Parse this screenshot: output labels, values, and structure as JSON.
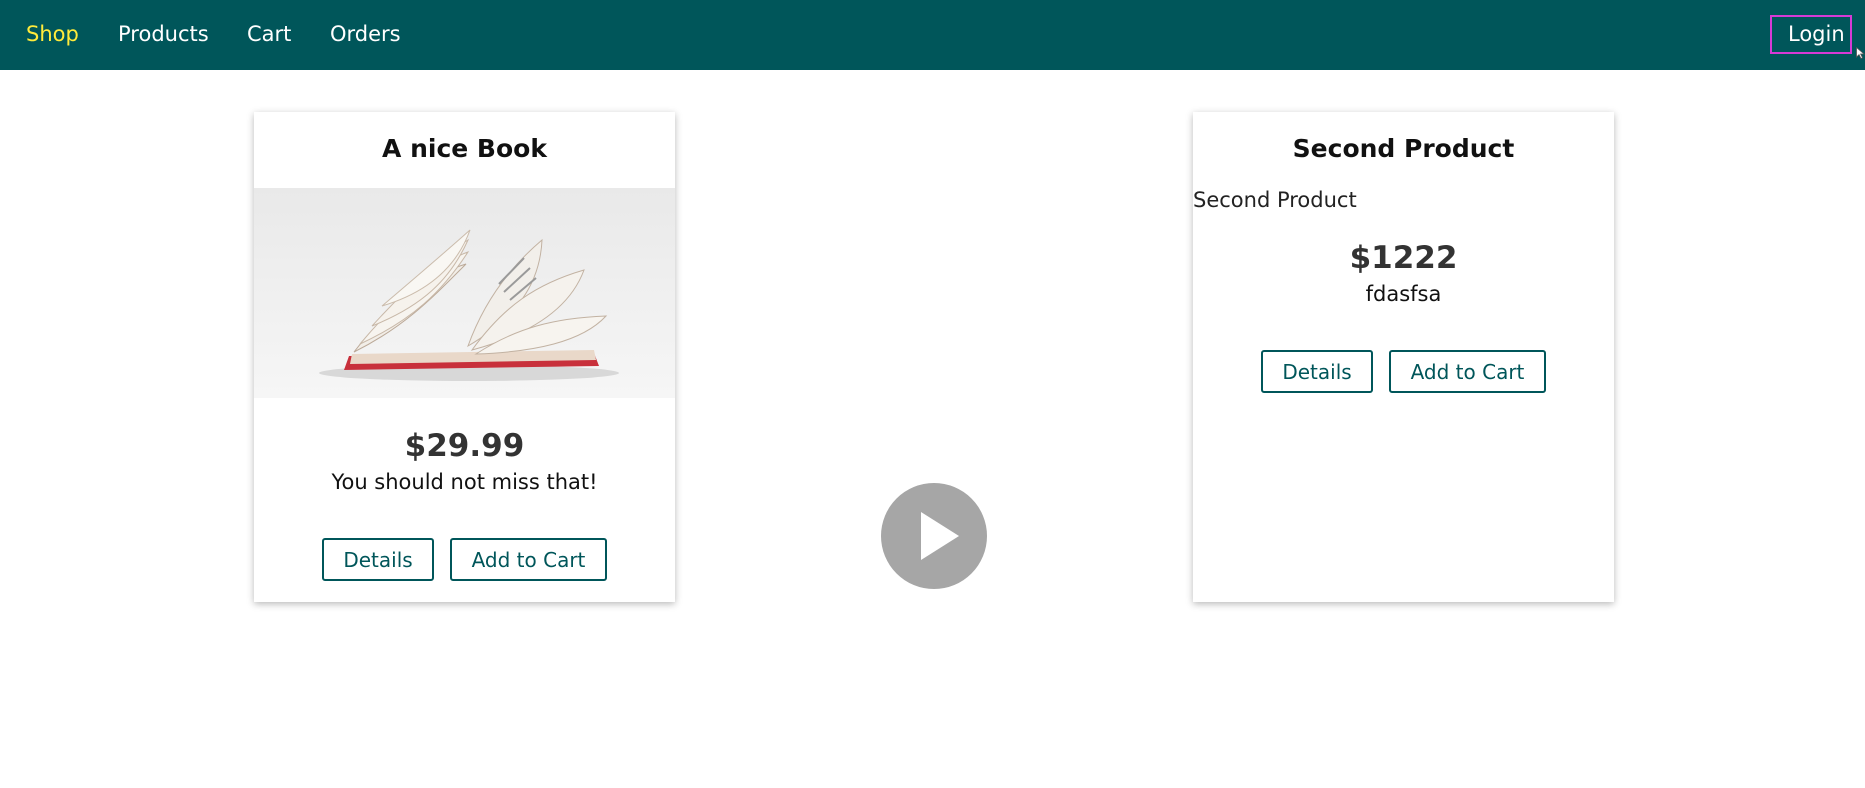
{
  "nav": {
    "items": [
      {
        "label": "Shop",
        "active": true
      },
      {
        "label": "Products",
        "active": false
      },
      {
        "label": "Cart",
        "active": false
      },
      {
        "label": "Orders",
        "active": false
      }
    ],
    "login_label": "Login"
  },
  "products": [
    {
      "title": "A nice Book",
      "price": "$29.99",
      "description": "You should not miss that!",
      "details_label": "Details",
      "add_to_cart_label": "Add to Cart"
    },
    {
      "title": "Second Product",
      "image_alt": "Second Product",
      "price": "$1222",
      "description": "fdasfsa",
      "details_label": "Details",
      "add_to_cart_label": "Add to Cart"
    }
  ],
  "colors": {
    "header_bg": "#00565a",
    "active_nav": "#ffeb3b",
    "button_border": "#00565a",
    "focus_outline": "#d63ad6",
    "play_button": "#a6a6a6"
  },
  "icons": {
    "play": "play-icon",
    "cursor": "cursor-icon"
  }
}
